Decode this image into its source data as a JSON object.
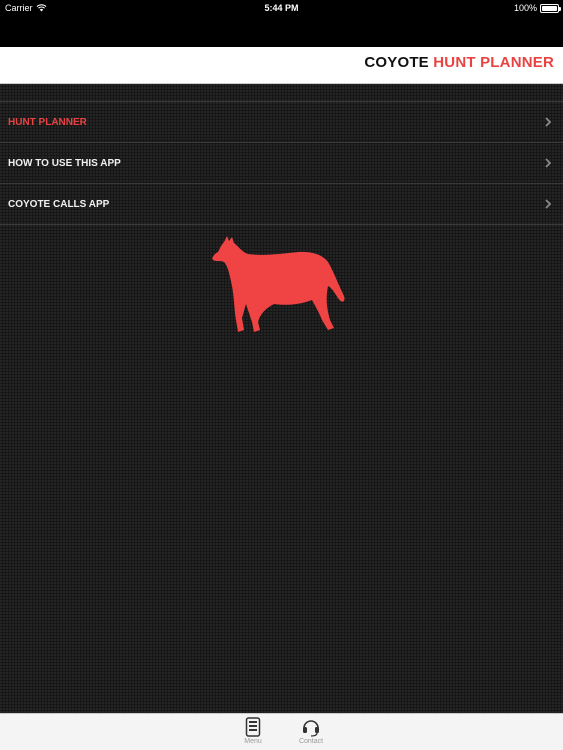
{
  "status_bar": {
    "carrier": "Carrier",
    "time": "5:44 PM",
    "battery": "100%",
    "battery_level": 1.0
  },
  "header": {
    "title_part1": "COYOTE ",
    "title_part2": "HUNT PLANNER",
    "accent_color": "#e84343"
  },
  "menu": {
    "items": [
      {
        "label": "HUNT PLANNER",
        "active": true,
        "icon": "chevron-right-icon"
      },
      {
        "label": "HOW TO USE THIS APP",
        "active": false,
        "icon": "chevron-right-icon"
      },
      {
        "label": "COYOTE CALLS APP",
        "active": false,
        "icon": "chevron-right-icon"
      }
    ]
  },
  "illustration": {
    "icon": "coyote-icon",
    "color": "#f04444"
  },
  "tab_bar": {
    "tabs": [
      {
        "label": "Menu",
        "icon": "menu-tab-icon"
      },
      {
        "label": "Contact",
        "icon": "headset-icon"
      }
    ]
  }
}
